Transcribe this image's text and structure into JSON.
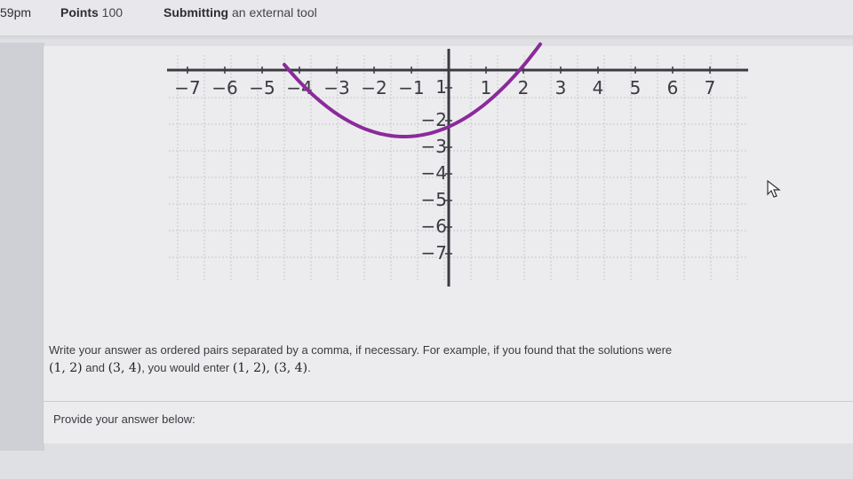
{
  "topbar": {
    "time": "59pm",
    "points_label": "Points",
    "points_value": "100",
    "submitting_label": "Submitting",
    "submitting_value": "an external tool"
  },
  "graph": {
    "x_ticks": [
      "−7",
      "−6",
      "−5",
      "−4",
      "−3",
      "−2",
      "−1",
      "1",
      "2",
      "3",
      "4",
      "5",
      "6",
      "7"
    ],
    "y_ticks": [
      "1",
      "−2",
      "−3",
      "−4",
      "−5",
      "−6",
      "−7"
    ],
    "curve_color": "#8b2a9a",
    "axis_color": "#3a3a40"
  },
  "instruction": {
    "text_before": "Write your answer as ordered pairs separated by a comma, if necessary. For example, if you found that the solutions were",
    "pair1": "(1, 2)",
    "and": "and",
    "pair2": "(3, 4)",
    "mid": ", you would enter",
    "answer_example": "(1, 2), (3, 4)",
    "end": "."
  },
  "provide_label": "Provide your answer below:"
}
